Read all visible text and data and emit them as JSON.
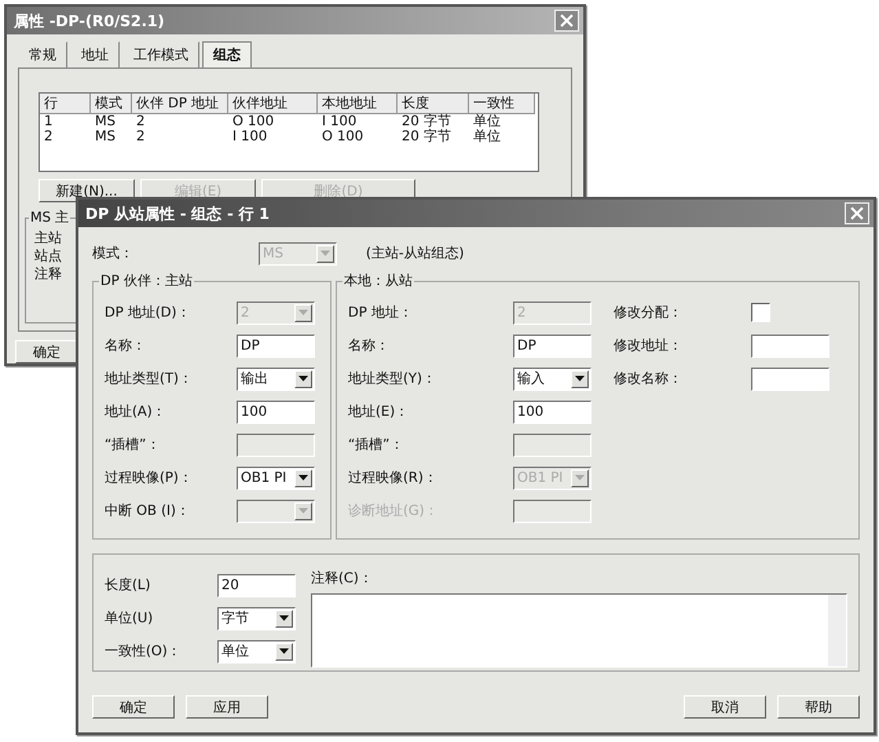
{
  "back_window": {
    "title": "属性 -DP-(R0/S2.1)",
    "tabs": [
      {
        "label": "常规",
        "selected": false
      },
      {
        "label": "地址",
        "selected": false
      },
      {
        "label": "工作模式",
        "selected": false
      },
      {
        "label": "组态",
        "selected": true
      }
    ],
    "table": {
      "columns": [
        "行",
        "模式",
        "伙伴 DP 地址",
        "伙伴地址",
        "本地地址",
        "长度",
        "一致性"
      ],
      "rows": [
        [
          "1",
          "MS",
          "2",
          "O 100",
          "I 100",
          "20 字节",
          "单位"
        ],
        [
          "2",
          "MS",
          "2",
          "I 100",
          "O 100",
          "20 字节",
          "单位"
        ]
      ]
    },
    "buttons": [
      {
        "label": "新建(N)...",
        "disabled": false
      },
      {
        "label": "编辑(E)",
        "disabled": true
      },
      {
        "label": "删除(D)",
        "disabled": true
      }
    ],
    "group": {
      "title": "MS 主",
      "labels": [
        "主站",
        "站点",
        "注释"
      ]
    },
    "ok_button": "确定"
  },
  "front_window": {
    "title": "DP 从站属性 - 组态 - 行 1",
    "mode": {
      "label": "模式：",
      "value": "MS",
      "disabled": true
    },
    "mode_note": "(主站-从站组态)",
    "partner": {
      "title": "DP 伙伴：主站",
      "fields": [
        {
          "label": "DP 地址(D)：",
          "kind": "combo",
          "value": "2",
          "disabled": true,
          "dimmed": false
        },
        {
          "label": "名称：",
          "kind": "text",
          "value": "DP",
          "disabled": false,
          "dimmed": false
        },
        {
          "label": "地址类型(T)：",
          "kind": "combo",
          "value": "输出",
          "disabled": false,
          "dimmed": false
        },
        {
          "label": "地址(A)：",
          "kind": "text",
          "value": "100",
          "disabled": false,
          "dimmed": false
        },
        {
          "label": "“插槽”：",
          "kind": "text",
          "disabled": true,
          "dimmed": false
        },
        {
          "label": "过程映像(P)：",
          "kind": "combo",
          "value": "OB1 PI",
          "disabled": false,
          "dimmed": false
        },
        {
          "label": "中断 OB (I)：",
          "kind": "combo",
          "disabled": true,
          "dimmed": false
        }
      ]
    },
    "local": {
      "title": "本地：从站",
      "fields": [
        {
          "label": "DP 地址：",
          "kind": "text",
          "value": "2",
          "disabled": true,
          "dimmed": false
        },
        {
          "label": "名称：",
          "kind": "text",
          "value": "DP",
          "disabled": false,
          "dimmed": false
        },
        {
          "label": "地址类型(Y)：",
          "kind": "combo",
          "value": "输入",
          "disabled": false,
          "dimmed": false
        },
        {
          "label": "地址(E)：",
          "kind": "text",
          "value": "100",
          "disabled": false,
          "dimmed": false
        },
        {
          "label": "“插槽”：",
          "kind": "text",
          "disabled": true,
          "dimmed": false
        },
        {
          "label": "过程映像(R)：",
          "kind": "combo",
          "value": "OB1 PI",
          "disabled": true,
          "dimmed": false
        },
        {
          "label": "诊断地址(G)：",
          "kind": "text",
          "disabled": true,
          "dimmed": true
        }
      ],
      "extra": [
        {
          "label": "修改分配：",
          "kind": "checkbox",
          "checked": false
        },
        {
          "label": "修改地址：",
          "kind": "text"
        },
        {
          "label": "修改名称：",
          "kind": "text"
        }
      ]
    },
    "bottom": {
      "fields": [
        {
          "label": "长度(L)",
          "kind": "text",
          "value": "20",
          "disabled": false,
          "dimmed": false
        },
        {
          "label": "单位(U)",
          "kind": "combo",
          "value": "字节",
          "disabled": false,
          "dimmed": false
        },
        {
          "label": "一致性(O)：",
          "kind": "combo",
          "value": "单位",
          "disabled": false,
          "dimmed": false
        }
      ],
      "comment_label": "注释(C)："
    },
    "buttons_left": [
      "确定",
      "应用"
    ],
    "buttons_right": [
      "取消",
      "帮助"
    ]
  }
}
